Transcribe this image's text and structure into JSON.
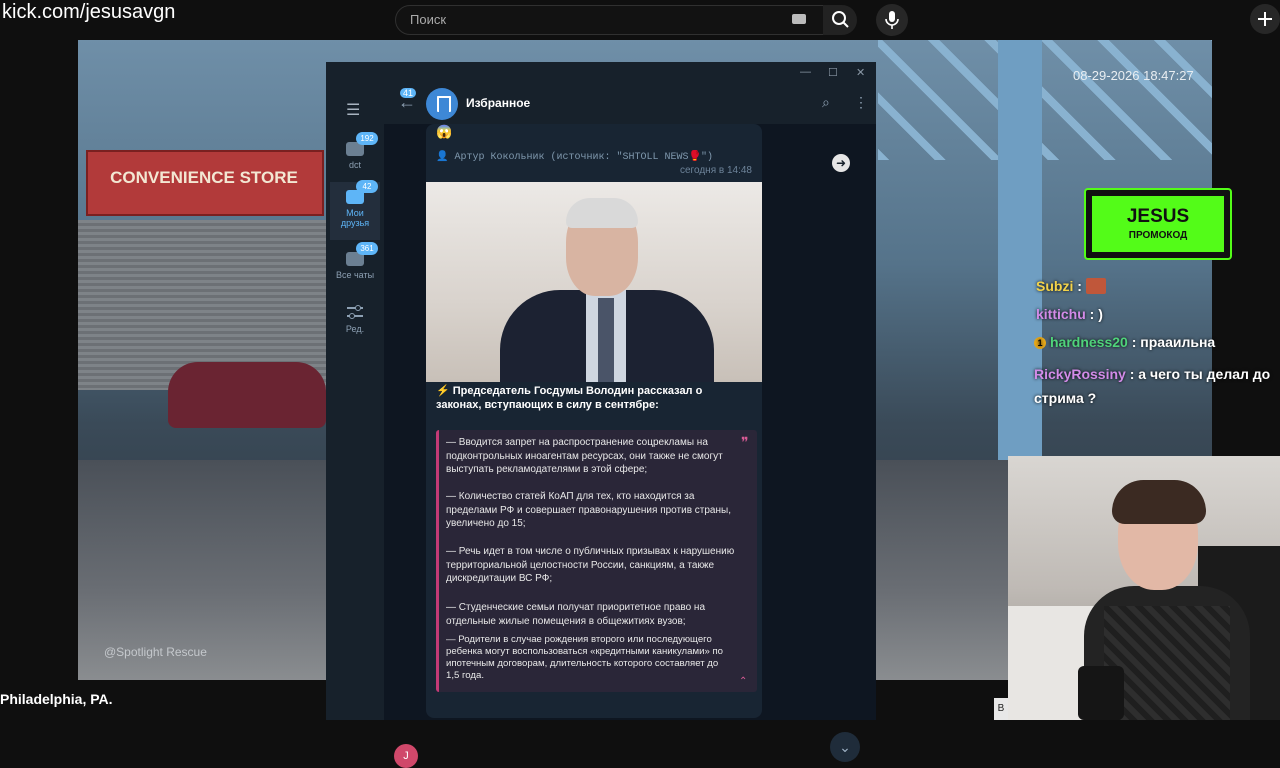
{
  "topbar": {
    "url": "kick.com/jesusavgn",
    "search_placeholder": "Поиск"
  },
  "video": {
    "timestamp": "08-29-2026 18:47:27",
    "store_sign": "CONVENIENCE STORE",
    "watermark": "@Spotlight Rescue",
    "location": "Philadelphia, PA."
  },
  "telegram": {
    "chat_title": "Избранное",
    "back_badge": "41",
    "folders": [
      {
        "label": "dct",
        "badge": "192"
      },
      {
        "label": "Мои друзья",
        "badge": "42"
      },
      {
        "label": "Все чаты",
        "badge": "361"
      },
      {
        "label": "Ред.",
        "badge": ""
      }
    ],
    "message": {
      "emoji": "😱",
      "forwarded": "👤 Артур Кокольник (источник: \"SHTOLL NEWS🥊\")",
      "time": "сегодня в 14:48",
      "lead": "⚡ Председатель Госдумы Володин рассказал о законах, вступающих в силу в сентябре:",
      "quote_items": [
        "— Вводится запрет на распространение соцрекламы на подконтрольных иноагентам ресурсах, они также не смогут выступать рекламодателями в этой сфере;",
        "— Количество статей КоАП для тех, кто находится за пределами РФ и совершает правонарушения против страны, увеличено до 15;",
        "— Речь идет в том числе о публичных призывах к нарушению территориальной целостности России, санкциям, а также дискредитации ВС РФ;",
        "— Студенческие семьи получат приоритетное право на отдельные жилые помещения в общежитиях вузов;",
        "— Родители в случае рождения второго или последующего ребенка могут воспользоваться «кредитными каникулами» по ипотечным договорам, длительность которого составляет до 1,5 года."
      ]
    },
    "user_avatar_letter": "J"
  },
  "overlay": {
    "promo_title": "JESUS",
    "promo_subtitle": "ПРОМОКОД",
    "chat": [
      {
        "user": "Subzi",
        "text": ""
      },
      {
        "user": "kittichu",
        "text": ": )"
      },
      {
        "user": "hardness20",
        "text": ": прааильна"
      },
      {
        "user": "RickyRossiny",
        "text": ": а чего ты делал до стрима ?"
      }
    ]
  },
  "bottom_chip": "В",
  "colors": {
    "kick_green": "#53fc18",
    "telegram_accent": "#5eb5f7",
    "quote_bar": "#c33a76"
  }
}
